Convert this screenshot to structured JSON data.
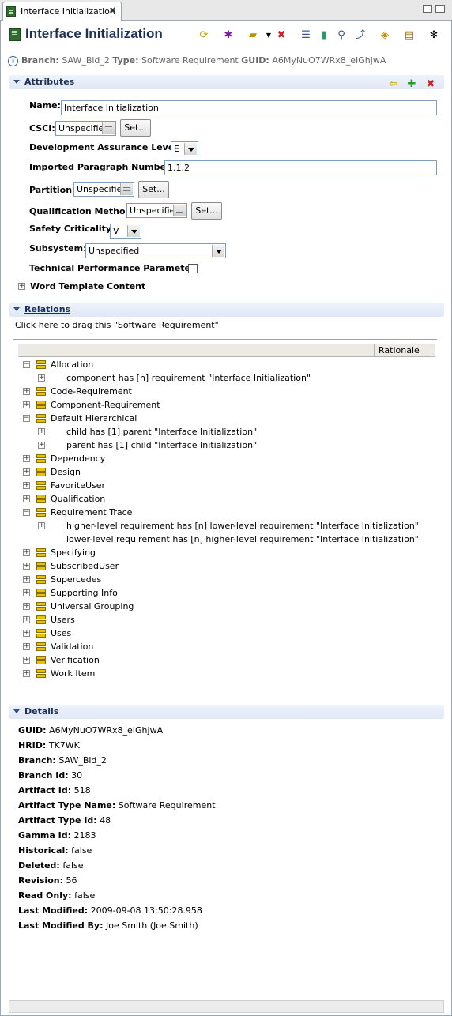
{
  "tab": {
    "title": "Interface Initialization",
    "close": "✖"
  },
  "header": {
    "title": "Interface Initialization",
    "info": {
      "branch_label": "Branch:",
      "branch": "SAW_Bld_2",
      "type_label": "Type:",
      "type": "Software Requirement",
      "guid_label": "GUID:",
      "guid": "A6MyNuO7WRx8_eIGhjwA"
    }
  },
  "attributes": {
    "title": "Attributes",
    "name_label": "Name:",
    "name_value": "Interface Initialization",
    "csci_label": "CSCI:",
    "csci_value": "Unspecified",
    "set_label": "Set...",
    "dal_label": "Development Assurance Level:",
    "dal_value": "E",
    "ipn_label": "Imported Paragraph Number:",
    "ipn_value": "1.1.2",
    "partition_label": "Partition:",
    "partition_value": "Unspecified",
    "qm_label": "Qualification Method:",
    "qm_value": "Unspecified",
    "safety_label": "Safety Criticality:",
    "safety_value": "V",
    "subsystem_label": "Subsystem:",
    "subsystem_value": "Unspecified",
    "tpp_label": "Technical Performance Parameter:",
    "word_template": "Word Template Content"
  },
  "relations": {
    "title": "Relations",
    "drag_text": "Click here to drag this \"Software Requirement\"",
    "rationale_header": "Rationale",
    "rows": [
      {
        "text": "Allocation",
        "level": 0,
        "expanded": true
      },
      {
        "text": "component has [n] requirement \"Interface Initialization\"",
        "level": 1,
        "plus": true
      },
      {
        "text": "Code-Requirement",
        "level": 0
      },
      {
        "text": "Component-Requirement",
        "level": 0
      },
      {
        "text": "Default Hierarchical",
        "level": 0,
        "expanded": true
      },
      {
        "text": "child has [1] parent \"Interface Initialization\"",
        "level": 1,
        "plus": true
      },
      {
        "text": "parent has [1] child \"Interface Initialization\"",
        "level": 1,
        "plus": true
      },
      {
        "text": "Dependency",
        "level": 0
      },
      {
        "text": "Design",
        "level": 0
      },
      {
        "text": "FavoriteUser",
        "level": 0
      },
      {
        "text": "Qualification",
        "level": 0
      },
      {
        "text": "Requirement Trace",
        "level": 0,
        "expanded": true
      },
      {
        "text": "higher-level requirement has [n] lower-level requirement \"Interface Initialization\"",
        "level": 1,
        "plus": true
      },
      {
        "text": "lower-level requirement has [n] higher-level requirement \"Interface Initialization\"",
        "level": 1,
        "plus": false
      },
      {
        "text": "Specifying",
        "level": 0
      },
      {
        "text": "SubscribedUser",
        "level": 0
      },
      {
        "text": "Supercedes",
        "level": 0
      },
      {
        "text": "Supporting Info",
        "level": 0
      },
      {
        "text": "Universal Grouping",
        "level": 0
      },
      {
        "text": "Users",
        "level": 0
      },
      {
        "text": "Uses",
        "level": 0
      },
      {
        "text": "Validation",
        "level": 0
      },
      {
        "text": "Verification",
        "level": 0
      },
      {
        "text": "Work Item",
        "level": 0
      }
    ]
  },
  "details": {
    "title": "Details",
    "rows": [
      {
        "label": "GUID:",
        "value": "A6MyNuO7WRx8_eIGhjwA"
      },
      {
        "label": "HRID:",
        "value": "TK7WK"
      },
      {
        "label": "Branch:",
        "value": "SAW_Bld_2"
      },
      {
        "label": "Branch Id:",
        "value": "30"
      },
      {
        "label": "Artifact Id:",
        "value": "518"
      },
      {
        "label": "Artifact Type Name:",
        "value": "Software Requirement"
      },
      {
        "label": "Artifact Type Id:",
        "value": "48"
      },
      {
        "label": "Gamma Id:",
        "value": "2183"
      },
      {
        "label": "Historical:",
        "value": "false"
      },
      {
        "label": "Deleted:",
        "value": "false"
      },
      {
        "label": "Revision:",
        "value": "56"
      },
      {
        "label": "Read Only:",
        "value": "false"
      },
      {
        "label": "Last Modified:",
        "value": "2009-09-08 13:50:28.958"
      },
      {
        "label": "Last Modified By:",
        "value": "Joe Smith (Joe Smith)"
      }
    ]
  },
  "toolbar_icons": [
    "refresh-icon",
    "bug-icon",
    "open-icon",
    "dropdown-icon",
    "delete-icon",
    "tree-icon",
    "cylinder-icon",
    "search-icon",
    "branch-icon",
    "tag-icon",
    "clipboard-icon",
    "pin-icon"
  ]
}
